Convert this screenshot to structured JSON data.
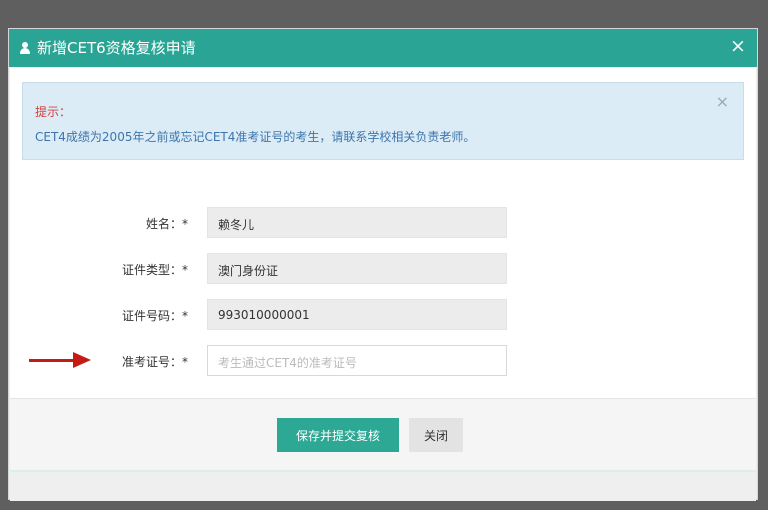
{
  "dialog": {
    "title": "新增CET6资格复核申请",
    "close_symbol": "×"
  },
  "alert": {
    "title": "提示：",
    "message": "CET4成绩为2005年之前或忘记CET4准考证号的考生，请联系学校相关负责老师。",
    "dismiss_symbol": "×"
  },
  "form": {
    "fields": [
      {
        "label": "姓名：",
        "required": "*",
        "value": "赖冬儿"
      },
      {
        "label": "证件类型：",
        "required": "*",
        "value": "澳门身份证"
      },
      {
        "label": "证件号码：",
        "required": "*",
        "value": "993010000001"
      },
      {
        "label": "准考证号：",
        "required": "*",
        "value": "",
        "placeholder": "考生通过CET4的准考证号"
      }
    ]
  },
  "actions": {
    "submit_label": "保存并提交复核",
    "close_label": "关闭"
  },
  "colors": {
    "header": "#2aa595",
    "primary_button": "#2ca894",
    "alert_title": "#d43f3a",
    "alert_background": "#dcecf7",
    "arrow": "#c51b16"
  }
}
